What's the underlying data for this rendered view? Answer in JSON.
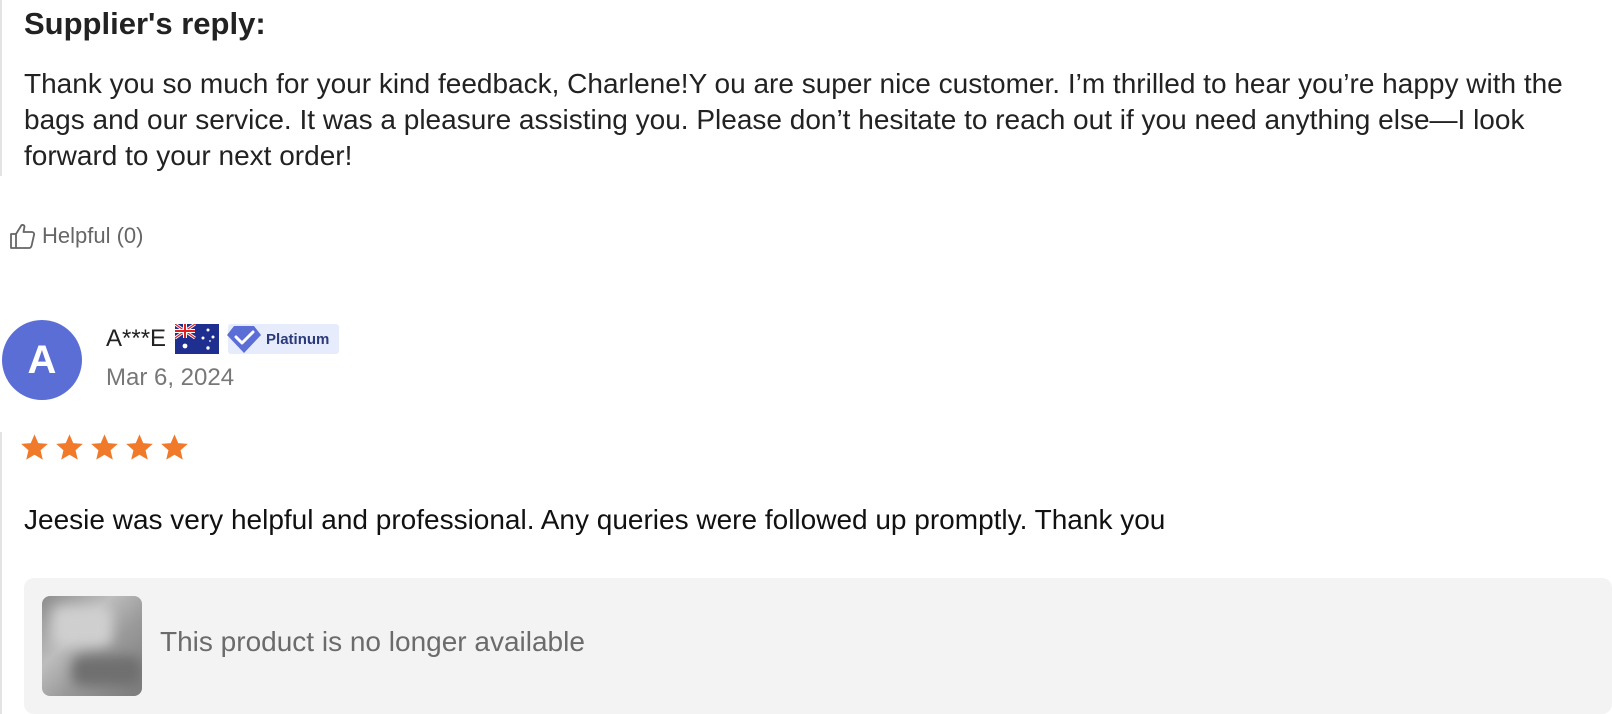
{
  "supplier_reply": {
    "title": "Supplier's reply:",
    "text": "Thank you so much for your kind feedback, Charlene!Y ou are super nice customer. I’m thrilled to hear you’re happy with the bags and our service. It was a pleasure assisting you. Please don’t hesitate to reach out if you need anything else—I look forward to your next order!"
  },
  "helpful": {
    "label": "Helpful (0)",
    "icon": "thumbs-up-icon"
  },
  "review": {
    "avatar_letter": "A",
    "avatar_color": "#5b6ed6",
    "reviewer_name": "A***E",
    "country_flag": "australia-flag-icon",
    "badge_label": "Platinum",
    "badge_icon": "verified-diamond-icon",
    "date": "Mar 6, 2024",
    "rating": 5,
    "rating_max": 5,
    "star_color": "#f07a2a",
    "text": "Jeesie was very helpful and professional. Any queries were followed up promptly. Thank you",
    "product": {
      "status": "This product is no longer available"
    }
  }
}
